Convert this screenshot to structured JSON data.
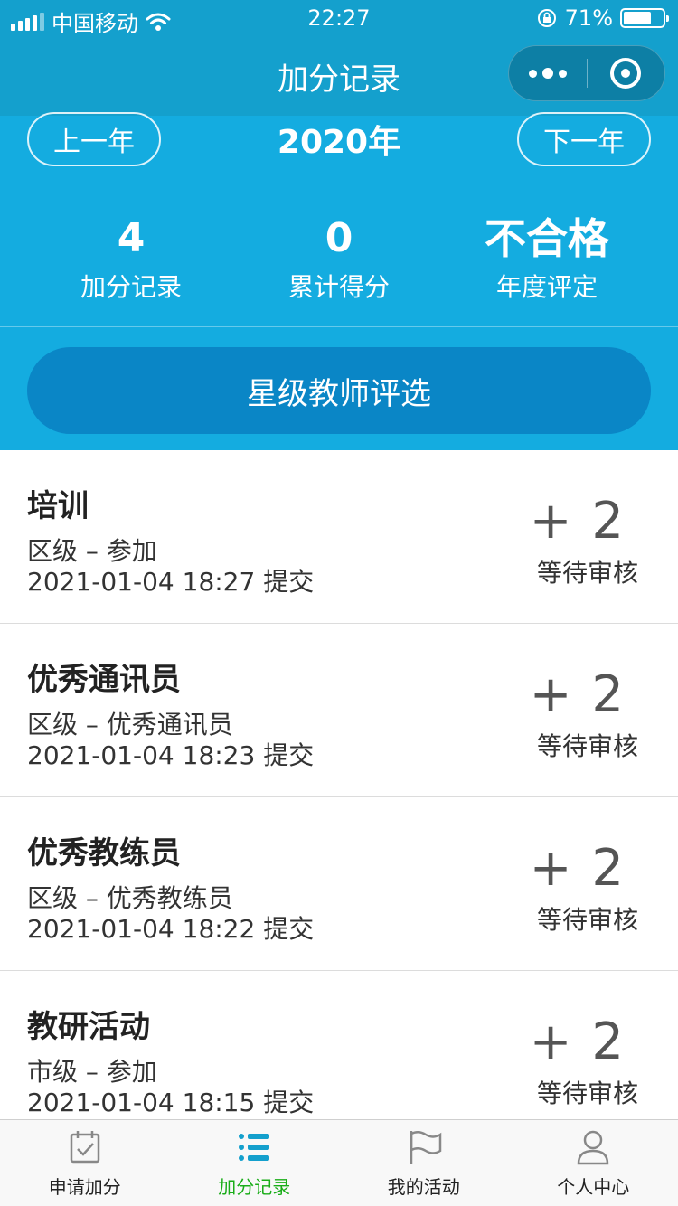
{
  "status_bar": {
    "carrier": "中国移动",
    "time": "22:27",
    "battery_percent": "71%",
    "battery_level": 0.71
  },
  "nav": {
    "title": "加分记录"
  },
  "year_selector": {
    "prev_label": "上一年",
    "current_year": "2020年",
    "next_label": "下一年"
  },
  "stats": [
    {
      "value": "4",
      "label": "加分记录"
    },
    {
      "value": "0",
      "label": "累计得分"
    },
    {
      "value": "不合格",
      "label": "年度评定"
    }
  ],
  "star_button": {
    "label": "星级教师评选"
  },
  "records": [
    {
      "title": "培训",
      "subtitle": "区级 – 参加",
      "time": "2021-01-04 18:27 提交",
      "score": "+ 2",
      "status": "等待审核"
    },
    {
      "title": "优秀通讯员",
      "subtitle": "区级 – 优秀通讯员",
      "time": "2021-01-04 18:23 提交",
      "score": "+ 2",
      "status": "等待审核"
    },
    {
      "title": "优秀教练员",
      "subtitle": "区级 – 优秀教练员",
      "time": "2021-01-04 18:22 提交",
      "score": "+ 2",
      "status": "等待审核"
    },
    {
      "title": "教研活动",
      "subtitle": "市级 – 参加",
      "time": "2021-01-04 18:15 提交",
      "score": "+ 2",
      "status": "等待审核"
    }
  ],
  "tabs": [
    {
      "label": "申请加分",
      "icon": "calendar-check-icon",
      "active": false
    },
    {
      "label": "加分记录",
      "icon": "list-icon",
      "active": true
    },
    {
      "label": "我的活动",
      "icon": "flag-icon",
      "active": false
    },
    {
      "label": "个人中心",
      "icon": "user-icon",
      "active": false
    }
  ],
  "colors": {
    "primary": "#14ace0",
    "nav": "#14a0cd",
    "button": "#0a86c6",
    "tab_active": "#1aad19"
  }
}
